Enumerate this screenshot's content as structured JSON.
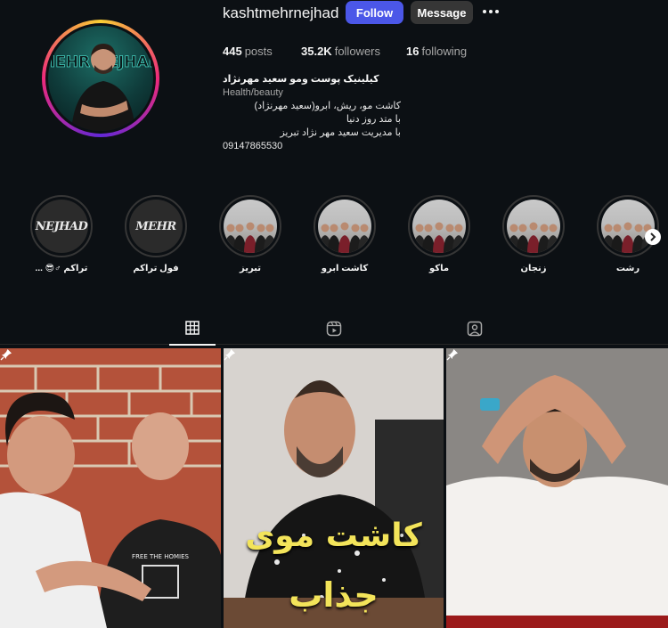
{
  "profile": {
    "username": "kashtmehrnejhad",
    "follow_label": "Follow",
    "message_label": "Message",
    "avatar_text": "MEHR NEJHAD"
  },
  "stats": {
    "posts_count": "445",
    "posts_label": "posts",
    "followers_count": "35.2K",
    "followers_label": "followers",
    "following_count": "16",
    "following_label": "following"
  },
  "bio": {
    "name": "کیلینیک پوست ومو سعید مهرنژاد",
    "category": "Health/beauty",
    "lines": [
      "کاشت مو، ریش، ابرو(سعید مهرنژاد)",
      "با متد روز دنیا",
      "با مدیریت سعید مهر نژاد تبریز",
      "09147865530"
    ]
  },
  "highlights": [
    {
      "label": "... 😎♂ تراکم",
      "image_text": "NEJHAD",
      "style": "logo"
    },
    {
      "label": "فول تراکم",
      "image_text": "MEHR",
      "style": "logo"
    },
    {
      "label": "تبریز",
      "style": "group"
    },
    {
      "label": "کاشت ابرو",
      "style": "group"
    },
    {
      "label": "ماکو",
      "style": "group"
    },
    {
      "label": "زنجان",
      "style": "group"
    },
    {
      "label": "رشت",
      "style": "group"
    }
  ],
  "tabs": [
    {
      "name": "posts",
      "icon": "grid-icon",
      "active": true
    },
    {
      "name": "reels",
      "icon": "reels-icon",
      "active": false
    },
    {
      "name": "tagged",
      "icon": "tagged-icon",
      "active": false
    }
  ],
  "posts": [
    {
      "pinned": true,
      "shirt_text": "FREE THE HOMIES"
    },
    {
      "pinned": true,
      "caption_line1": "کاشت موی",
      "caption_line2": "جذاب"
    },
    {
      "pinned": true
    }
  ],
  "colors": {
    "background": "#0c1014",
    "follow_button": "#4b57e8",
    "message_button": "#363636",
    "caption_yellow": "#f3e45a"
  }
}
